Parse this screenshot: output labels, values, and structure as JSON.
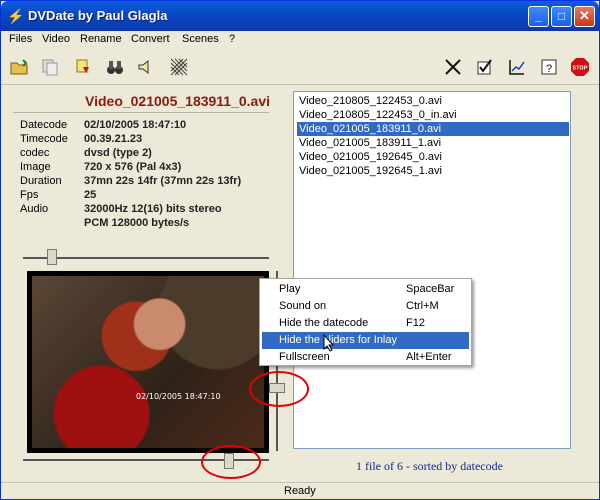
{
  "window": {
    "title": "DVDate by Paul Glagla",
    "icon": "dvdate-app-icon"
  },
  "menu": [
    "Files",
    "Video",
    "Rename",
    "Convert",
    "Scenes",
    "?"
  ],
  "toolbar": {
    "left": [
      "open-folder-icon",
      "copy-icon",
      "marker-icon",
      "binoculars-icon",
      "speaker-icon",
      "grid-icon"
    ],
    "right": [
      "delete-x-icon",
      "checkmark-icon",
      "chart-icon",
      "help-icon",
      "stop-icon"
    ]
  },
  "file_info": {
    "title": "Video_021005_183911_0.avi",
    "rows": [
      {
        "label": "Datecode",
        "value": "02/10/2005 18:47:10"
      },
      {
        "label": "Timecode",
        "value": "00.39.21.23"
      },
      {
        "label": "codec",
        "value": "dvsd (type 2)"
      },
      {
        "label": "Image",
        "value": "720 x 576 (Pal 4x3)"
      },
      {
        "label": "Duration",
        "value": "37mn 22s 14fr (37mn 22s 13fr)"
      },
      {
        "label": "Fps",
        "value": "25"
      },
      {
        "label": "Audio",
        "value": "32000Hz 12(16) bits  stereo"
      },
      {
        "label": "",
        "value": "PCM 128000 bytes/s"
      }
    ]
  },
  "video": {
    "overlay_datecode": "02/10/2005 18:47:10"
  },
  "files": {
    "items": [
      "Video_210805_122453_0.avi",
      "Video_210805_122453_0_in.avi",
      "Video_021005_183911_0.avi",
      "Video_021005_183911_1.avi",
      "Video_021005_192645_0.avi",
      "Video_021005_192645_1.avi"
    ],
    "selected_index": 2,
    "summary": "1 file of 6 - sorted by datecode"
  },
  "context_menu": [
    {
      "label": "Play",
      "shortcut": "SpaceBar"
    },
    {
      "label": "Sound on",
      "shortcut": "Ctrl+M"
    },
    {
      "label": "Hide the datecode",
      "shortcut": "F12"
    },
    {
      "label": "Hide the sliders for Inlay",
      "shortcut": ""
    },
    {
      "label": "Fullscreen",
      "shortcut": "Alt+Enter"
    }
  ],
  "context_active_index": 3,
  "status": "Ready",
  "colors": {
    "accent": "#316ac5",
    "title": "#8b1a10",
    "annotation": "#e30000"
  }
}
